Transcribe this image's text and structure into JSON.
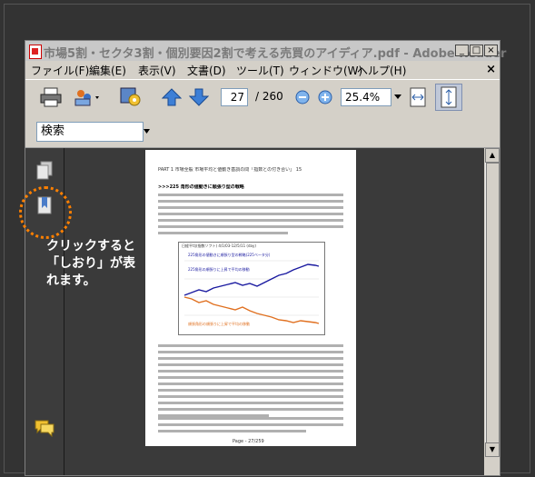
{
  "window": {
    "title": "市場5割・セクタ3割・個別要因2割で考える売買のアイディア.pdf - Adobe Reader",
    "doc_close": "×"
  },
  "menu": [
    "ファイル(F)",
    "編集(E)",
    "表示(V)",
    "文書(D)",
    "ツール(T)",
    "ウィンドウ(W)",
    "ヘルプ(H)"
  ],
  "toolbar": {
    "page_current": "27",
    "page_total": "/ 260",
    "zoom": "25.4%"
  },
  "search": {
    "value": "検索"
  },
  "page": {
    "header": "PART 1  市場全般  市場平均と値動き基調の問「指数との付き合い」 15",
    "heading": ">>>225 角形の値動きに順張り型の戦略",
    "chart_title": "日経平均(指数ソフト) 4/1/03-12/5/11 (day)",
    "chart_legend_1": "225角形の値動きに順張り型の戦略(225ベータ分)",
    "chart_legend_2": "225角形の順張りに上昇で平均の移動",
    "chart_legend_3": "順張角形の順張りに上昇で平均の移動",
    "footer": "Page - 27/259"
  },
  "callout": {
    "text": "クリックすると\n「しおり」が表\nれます。",
    "color": "#ff8000"
  }
}
